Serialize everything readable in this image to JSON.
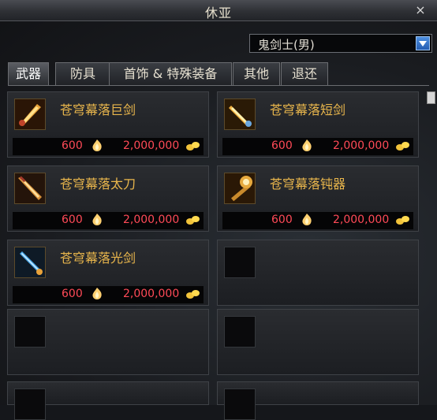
{
  "window": {
    "title": "休亚",
    "close_glyph": "×"
  },
  "job_select": {
    "value": "鬼剑士(男)",
    "arrow_icon": "chevron-down-icon"
  },
  "tabs": [
    {
      "label": "武器",
      "active": true
    },
    {
      "label": "防具",
      "active": false
    },
    {
      "label": "首饰 & 特殊装备",
      "active": false
    },
    {
      "label": "其他",
      "active": false
    },
    {
      "label": "退还",
      "active": false
    }
  ],
  "items": [
    {
      "name": "苍穹幕落巨剑",
      "price_a": "600",
      "price_b": "2,000,000",
      "icon": "greatsword-icon"
    },
    {
      "name": "苍穹幕落短剑",
      "price_a": "600",
      "price_b": "2,000,000",
      "icon": "shortsword-icon"
    },
    {
      "name": "苍穹幕落太刀",
      "price_a": "600",
      "price_b": "2,000,000",
      "icon": "katana-icon"
    },
    {
      "name": "苍穹幕落钝器",
      "price_a": "600",
      "price_b": "2,000,000",
      "icon": "blunt-weapon-icon"
    },
    {
      "name": "苍穹幕落光剑",
      "price_a": "600",
      "price_b": "2,000,000",
      "icon": "lightsaber-icon"
    }
  ],
  "colors": {
    "item_name": "#e9b64c",
    "price": "#ff4a57"
  }
}
